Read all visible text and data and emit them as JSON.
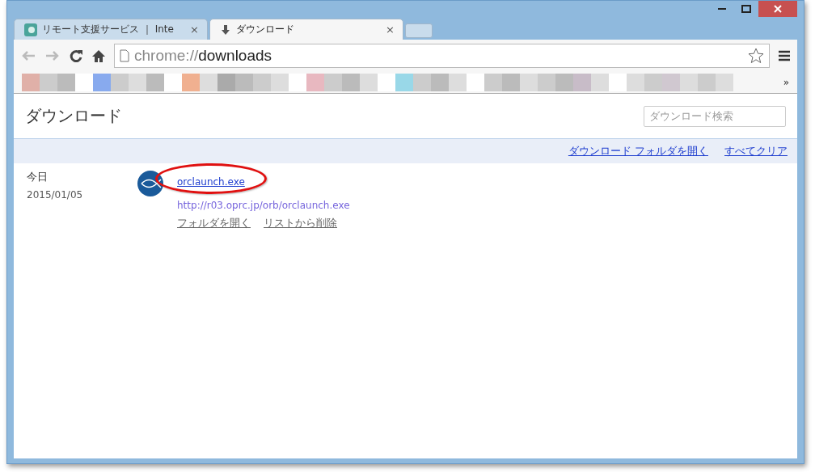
{
  "tabs": [
    {
      "kind": "page",
      "title": "リモート支援サービス ｜ Inte",
      "close": "×",
      "selected": false
    },
    {
      "kind": "download",
      "title": "ダウンロード",
      "close": "×",
      "selected": true
    }
  ],
  "toolbar": {
    "address_scheme": "chrome://",
    "address_path": "downloads"
  },
  "bookmarks_bar": {
    "overflow": "»"
  },
  "page": {
    "title": "ダウンロード",
    "search": {
      "placeholder": "ダウンロード検索"
    },
    "actions": [
      "ダウンロード フォルダを開く",
      "すべてクリア"
    ],
    "groups": [
      {
        "day": "今日",
        "date": "2015/01/05",
        "items": [
          {
            "file": "orclaunch.exe",
            "url": "http://r03.oprc.jp/orb/orclaunch.exe",
            "highlighted": true,
            "actions": [
              "フォルダを開く",
              "リストから削除"
            ]
          }
        ]
      }
    ]
  }
}
